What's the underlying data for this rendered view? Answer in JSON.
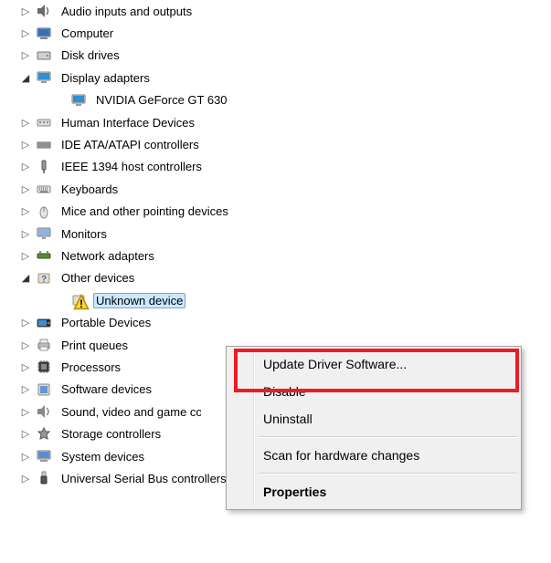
{
  "tree": {
    "items": [
      {
        "label": "Audio inputs and outputs",
        "expander": "closed",
        "icon": "audio"
      },
      {
        "label": "Computer",
        "expander": "closed",
        "icon": "computer"
      },
      {
        "label": "Disk drives",
        "expander": "closed",
        "icon": "disk"
      },
      {
        "label": "Display adapters",
        "expander": "open",
        "icon": "display"
      },
      {
        "label": "NVIDIA GeForce GT 630",
        "expander": "none",
        "icon": "display",
        "indent": "child"
      },
      {
        "label": "Human Interface Devices",
        "expander": "closed",
        "icon": "hid"
      },
      {
        "label": "IDE ATA/ATAPI controllers",
        "expander": "closed",
        "icon": "ide"
      },
      {
        "label": "IEEE 1394 host controllers",
        "expander": "closed",
        "icon": "ieee"
      },
      {
        "label": "Keyboards",
        "expander": "closed",
        "icon": "keyboard"
      },
      {
        "label": "Mice and other pointing devices",
        "expander": "closed",
        "icon": "mouse"
      },
      {
        "label": "Monitors",
        "expander": "closed",
        "icon": "monitor"
      },
      {
        "label": "Network adapters",
        "expander": "closed",
        "icon": "network"
      },
      {
        "label": "Other devices",
        "expander": "open",
        "icon": "other"
      },
      {
        "label": "Unknown device",
        "expander": "none",
        "icon": "unknown",
        "indent": "child",
        "selected": true
      },
      {
        "label": "Portable Devices",
        "expander": "closed",
        "icon": "portable"
      },
      {
        "label": "Print queues",
        "expander": "closed",
        "icon": "printer"
      },
      {
        "label": "Processors",
        "expander": "closed",
        "icon": "cpu"
      },
      {
        "label": "Software devices",
        "expander": "closed",
        "icon": "software"
      },
      {
        "label": "Sound, video and game controllers",
        "expander": "closed",
        "icon": "sound",
        "truncated": true
      },
      {
        "label": "Storage controllers",
        "expander": "closed",
        "icon": "storage"
      },
      {
        "label": "System devices",
        "expander": "closed",
        "icon": "system"
      },
      {
        "label": "Universal Serial Bus controllers",
        "expander": "closed",
        "icon": "usb"
      }
    ]
  },
  "context_menu": {
    "items": [
      {
        "label": "Update Driver Software...",
        "type": "item",
        "highlighted": true
      },
      {
        "label": "Disable",
        "type": "item"
      },
      {
        "label": "Uninstall",
        "type": "item"
      },
      {
        "type": "sep"
      },
      {
        "label": "Scan for hardware changes",
        "type": "item"
      },
      {
        "type": "sep"
      },
      {
        "label": "Properties",
        "type": "item",
        "bold": true
      }
    ]
  }
}
